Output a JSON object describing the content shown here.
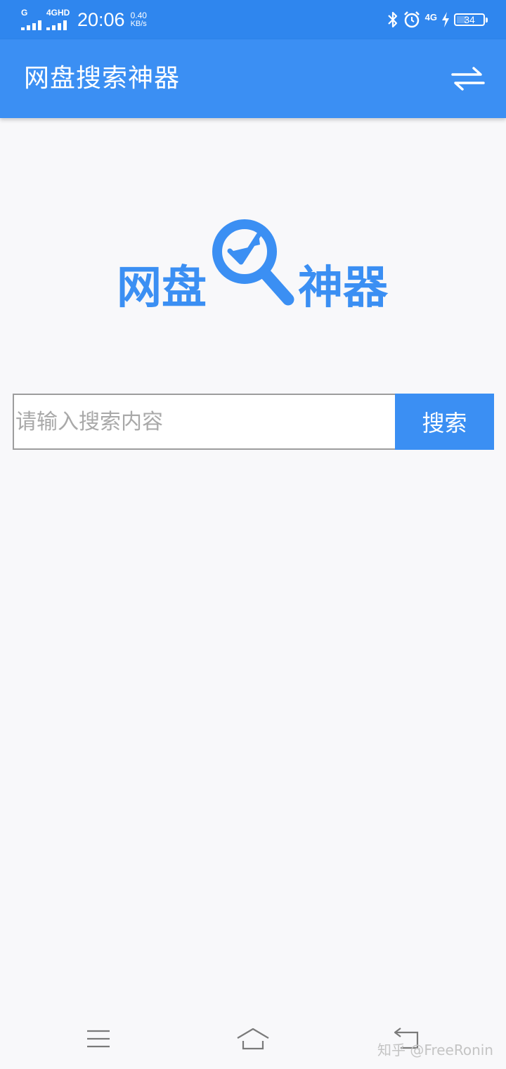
{
  "status_bar": {
    "sim1_label": "G",
    "sim2_label": "4GHD",
    "time": "20:06",
    "net_speed_value": "0.40",
    "net_speed_unit": "KB/s",
    "network_type": "4G",
    "battery_level": "34"
  },
  "app_bar": {
    "title": "网盘搜索神器",
    "swap_icon": "swap-arrows-icon"
  },
  "logo": {
    "left_text": "网盘",
    "right_text": "神器",
    "icon": "magnifier-check-icon"
  },
  "search": {
    "placeholder": "请输入搜索内容",
    "value": "",
    "button_label": "搜索"
  },
  "nav_bar": {
    "menu_icon": "menu-icon",
    "home_icon": "home-icon",
    "back_icon": "back-icon"
  },
  "watermark": "知乎 @FreeRonin",
  "colors": {
    "status_bar": "#2f86ee",
    "primary": "#3b8ff3",
    "background": "#f8f8fa",
    "placeholder": "#a9a9a9"
  }
}
